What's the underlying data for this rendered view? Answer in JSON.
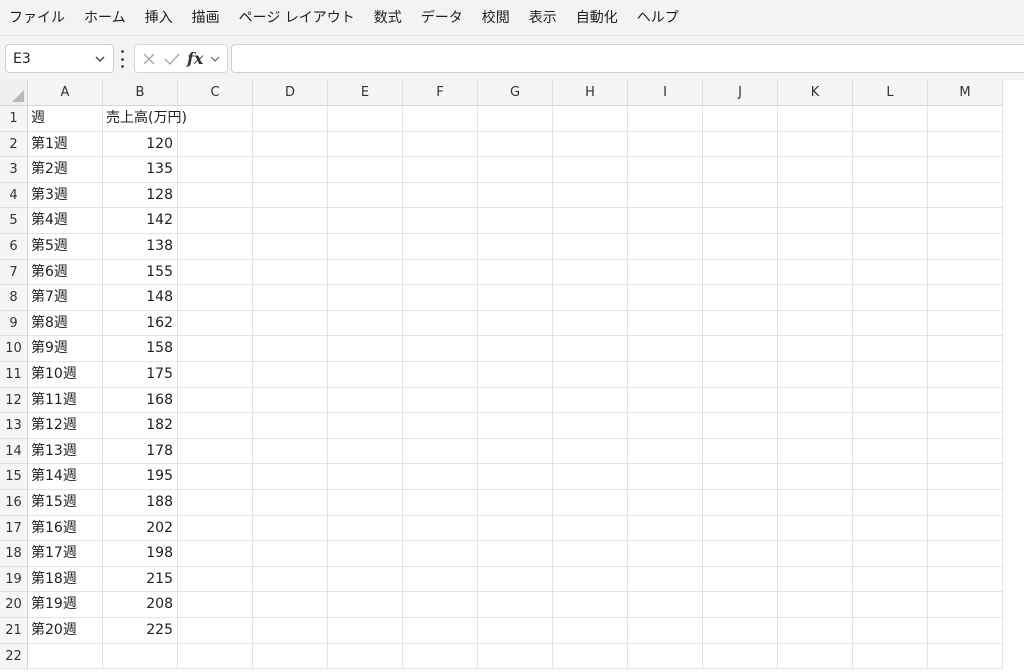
{
  "menu": [
    "ファイル",
    "ホーム",
    "挿入",
    "描画",
    "ページ レイアウト",
    "数式",
    "データ",
    "校閲",
    "表示",
    "自動化",
    "ヘルプ"
  ],
  "formula_bar": {
    "name_box": "E3",
    "fx_label": "fx",
    "formula": ""
  },
  "columns": [
    "A",
    "B",
    "C",
    "D",
    "E",
    "F",
    "G",
    "H",
    "I",
    "J",
    "K",
    "L",
    "M"
  ],
  "row_numbers": [
    "1",
    "2",
    "3",
    "4",
    "5",
    "6",
    "7",
    "8",
    "9",
    "10",
    "11",
    "12",
    "13",
    "14",
    "15",
    "16",
    "17",
    "18",
    "19",
    "20",
    "21",
    "22"
  ],
  "sheet": {
    "header": [
      "週",
      "売上高(万円)"
    ],
    "rows": [
      [
        "第1週",
        "120"
      ],
      [
        "第2週",
        "135"
      ],
      [
        "第3週",
        "128"
      ],
      [
        "第4週",
        "142"
      ],
      [
        "第5週",
        "138"
      ],
      [
        "第6週",
        "155"
      ],
      [
        "第7週",
        "148"
      ],
      [
        "第8週",
        "162"
      ],
      [
        "第9週",
        "158"
      ],
      [
        "第10週",
        "175"
      ],
      [
        "第11週",
        "168"
      ],
      [
        "第12週",
        "182"
      ],
      [
        "第13週",
        "178"
      ],
      [
        "第14週",
        "195"
      ],
      [
        "第15週",
        "188"
      ],
      [
        "第16週",
        "202"
      ],
      [
        "第17週",
        "198"
      ],
      [
        "第18週",
        "215"
      ],
      [
        "第19週",
        "208"
      ],
      [
        "第20週",
        "225"
      ]
    ]
  },
  "colors": {
    "chrome_bg": "#f3f3f3",
    "header_bg": "#f5f5f5",
    "gridline": "#e3e3e3"
  },
  "icons": {
    "name_box_dropdown": "chevron-down-icon",
    "more": "vertical-dots-icon",
    "cancel": "close-icon",
    "enter": "check-icon",
    "function_dropdown": "chevron-down-icon"
  }
}
